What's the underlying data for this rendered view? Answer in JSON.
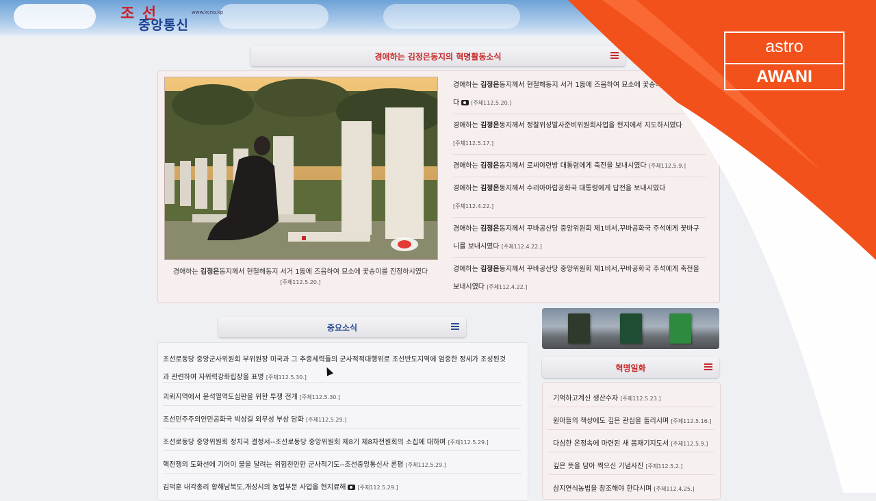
{
  "header": {
    "logo_top": "조 선",
    "logo_bottom": "중앙통신",
    "logo_url": "www.kcna.kp"
  },
  "leader_section": {
    "title": "경애하는 김정은동지의 혁명활동소식",
    "photo_caption_pre": "경애하는 ",
    "photo_caption_bold": "김정은",
    "photo_caption_post": "동지께서 현철해동지 서거 1돐에 즈음하여 묘소에 꽃송이를 진정하시였다",
    "photo_caption_date": "[주체112.5.20.]",
    "items": [
      {
        "pre": "경애하는 ",
        "bold": "김정은",
        "post": "동지께서 현철해동지 서거 1돐에 즈음하여 묘소에 꽃송이를 진정하시였",
        "post2": "다",
        "camera": true,
        "date": "[주체112.5.20.]"
      },
      {
        "pre": "경애하는 ",
        "bold": "김정은",
        "post": "동지께서 정찰위성발사준비위원회사업을 현지에서 지도하시였다",
        "post2": "",
        "camera": false,
        "date": "[주체112.5.17.]"
      },
      {
        "pre": "경애하는 ",
        "bold": "김정은",
        "post": "동지께서 로씨야련방 대통령에게 축전을 보내시였다",
        "post2": "",
        "camera": false,
        "date": "[주체112.5.9.]"
      },
      {
        "pre": "경애하는 ",
        "bold": "김정은",
        "post": "동지께서 수리아아랍공화국 대통령에게 답전을 보내시였다",
        "post2": "",
        "camera": false,
        "date": "[주체112.4.22.]"
      },
      {
        "pre": "경애하는 ",
        "bold": "김정은",
        "post": "동지께서 꾸바공산당 중앙위원회 제1비서,꾸바공화국 주석에게 꽃바구",
        "post2": "니를 보내시였다",
        "camera": false,
        "date": "[주체112.4.22.]"
      },
      {
        "pre": "경애하는 ",
        "bold": "김정은",
        "post": "동지께서 꾸바공산당 중앙위원회 제1비서,꾸바공화국 주석에게 축전을",
        "post2": "보내시였다",
        "camera": false,
        "date": "[주체112.4.22.]"
      }
    ]
  },
  "important_news": {
    "title": "중요소식",
    "items": [
      {
        "text": "조선로동당 중앙군사위원회 부위원장 미국과 그 추종세력들의 군사적적대행위로 조선반도지역에 엄중한 정세가 조성된것",
        "text2": "과 관련하여 자위력강화립장을 표명",
        "camera": false,
        "date": "[주체112.5.30.]"
      },
      {
        "text": "괴뢰지역에서 윤석열역도심판을 위한 투쟁 전개",
        "text2": "",
        "camera": false,
        "date": "[주체112.5.30.]"
      },
      {
        "text": "조선민주주의인민공화국 박상길 외무성 부상 담화",
        "text2": "",
        "camera": false,
        "date": "[주체112.5.29.]"
      },
      {
        "text": "조선로동당 중앙위원회 정치국 결정서--조선로동당 중앙위원회 제8기 제8차전원회의 소집에 대하여",
        "text2": "",
        "camera": false,
        "date": "[주체112.5.29.]"
      },
      {
        "text": "핵전쟁의 도화선에 기어이 불을 달려는 위험천만한 군사적기도--조선중앙통신사 론평",
        "text2": "",
        "camera": false,
        "date": "[주체112.5.29.]"
      },
      {
        "text": "김덕훈 내각총리 황해남북도,개성시의 농업부문 사업을 현지료해",
        "text2": "",
        "camera": true,
        "date": "[주체112.5.29.]"
      }
    ]
  },
  "revolution_stories": {
    "title": "혁명일화",
    "items": [
      {
        "text": "기억하고계신 생산수자",
        "date": "[주체112.5.23.]"
      },
      {
        "text": "원아들의 책상에도 깊은 관심을 돌리시며",
        "date": "[주체112.5.16.]"
      },
      {
        "text": "다심한 온정속에 마련된 새 몸재기지도서",
        "date": "[주체112.5.9.]"
      },
      {
        "text": "깊은 뜻을 담아 찍으신 기념사진",
        "date": "[주체112.5.2.]"
      },
      {
        "text": "삼지연식농법을 창조해야 한다시며",
        "date": "[주체112.4.25.]"
      }
    ]
  },
  "broadcast_logo": {
    "line1": "astro",
    "line2": "AWANI"
  },
  "colors": {
    "accent_red": "#c62828",
    "accent_blue": "#2a4d8f",
    "overlay_orange": "#f2511b"
  },
  "icons": [
    "list-menu-icon",
    "camera-icon",
    "mouse-cursor-icon"
  ]
}
